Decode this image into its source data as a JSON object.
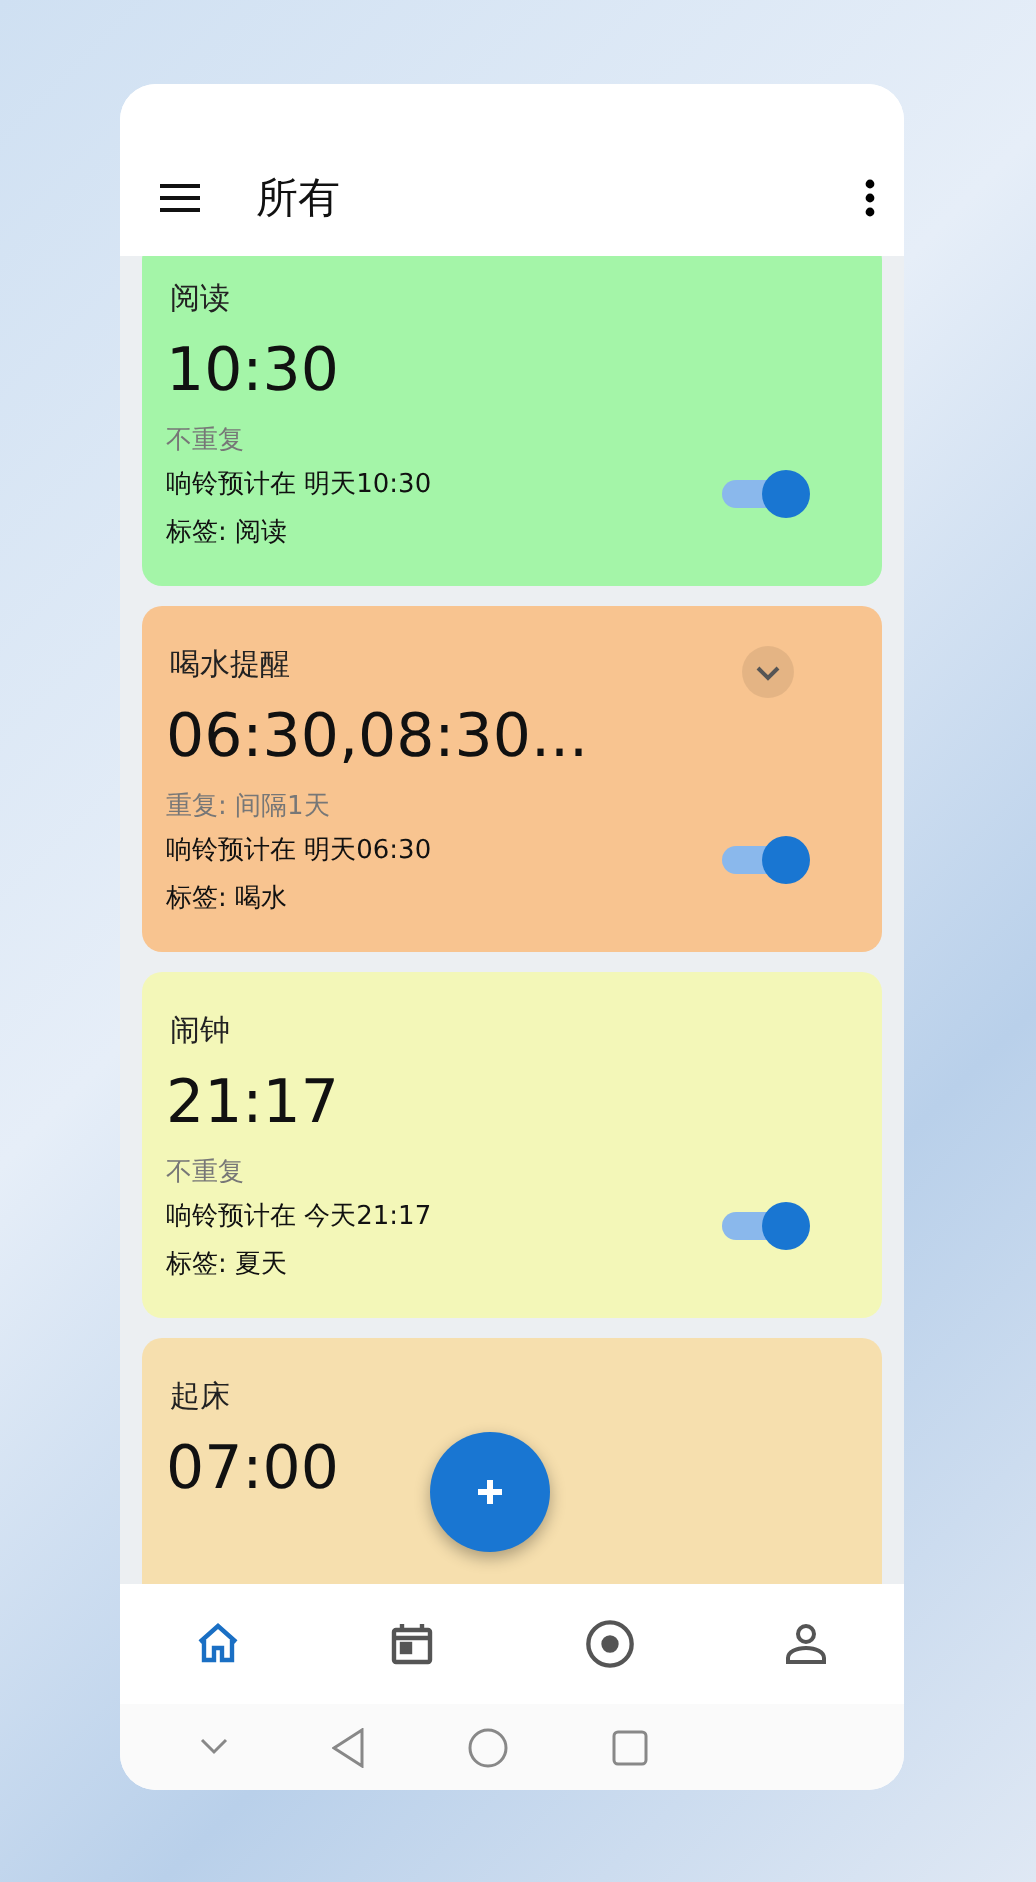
{
  "app_bar": {
    "title": "所有"
  },
  "alarms": [
    {
      "title": "阅读",
      "time": "10:30",
      "repeat": "不重复",
      "next": "响铃预计在 明天10:30",
      "tag": "标签: 阅读",
      "on": true,
      "collapse_button": false,
      "color": "#a4f5a8"
    },
    {
      "title": "喝水提醒",
      "time": "06:30,08:30...",
      "repeat": "重复:  间隔1天",
      "next": "响铃预计在 明天06:30",
      "tag": "标签: 喝水",
      "on": true,
      "collapse_button": true,
      "color": "#f8c490"
    },
    {
      "title": "闹钟",
      "time": "21:17",
      "repeat": "不重复",
      "next": "响铃预计在 今天21:17",
      "tag": "标签: 夏天",
      "on": true,
      "collapse_button": false,
      "color": "#f3f7b8"
    },
    {
      "title": "起床",
      "time": "07:00",
      "collapse_button": false,
      "color": "#f6dfae"
    }
  ],
  "bottom_nav": [
    {
      "kind": "home",
      "selected": true
    },
    {
      "kind": "calendar",
      "selected": false
    },
    {
      "kind": "target",
      "selected": false
    },
    {
      "kind": "person",
      "selected": false
    }
  ]
}
